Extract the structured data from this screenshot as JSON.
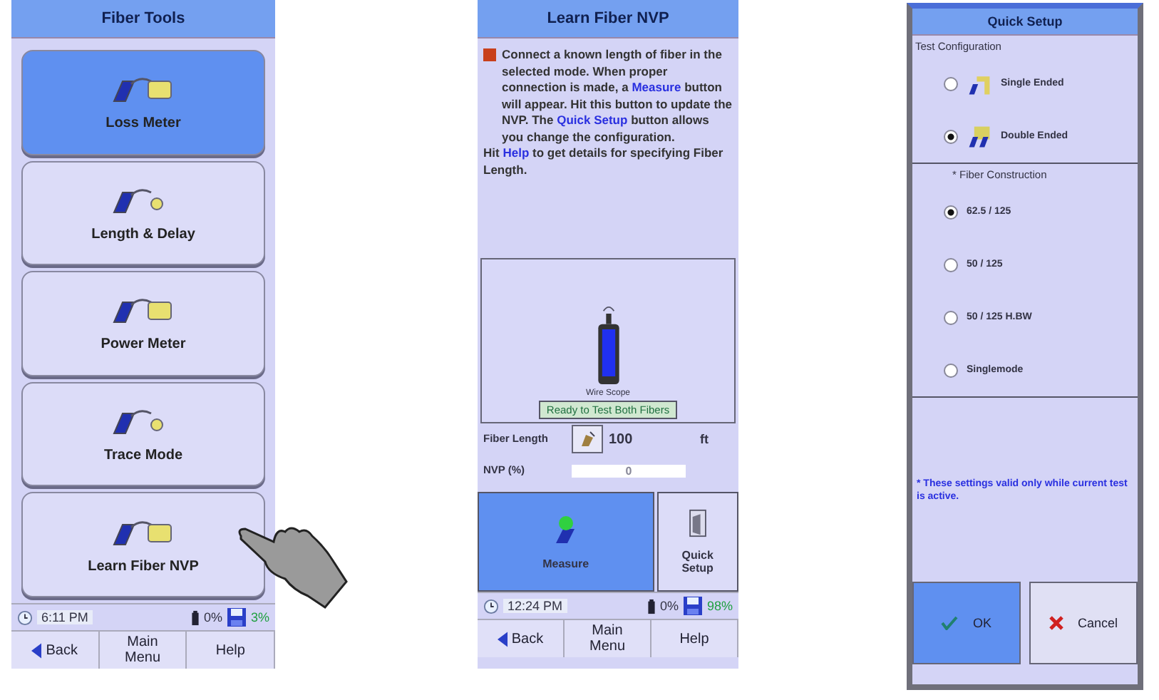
{
  "screens": [
    {
      "kind": "menu",
      "title": "Fiber Tools",
      "tiles": [
        {
          "label": "Loss Meter",
          "selected": true
        },
        {
          "label": "Length & Delay",
          "selected": false
        },
        {
          "label": "Power Meter",
          "selected": false
        },
        {
          "label": "Trace Mode",
          "selected": false
        },
        {
          "label": "Learn Fiber NVP",
          "selected": false
        }
      ],
      "status": {
        "time": "6:11 PM",
        "battery": "0%",
        "storage": "3%"
      },
      "nav": [
        "Back",
        "Main Menu",
        "Help"
      ]
    },
    {
      "kind": "nvp",
      "title": "Learn Fiber NVP",
      "paragraphs": [
        [
          {
            "text": "Connect a known length of fiber in the selected mode. When proper connection is made, a",
            "kind": "text"
          },
          {
            "text": "Measure",
            "kind": "link"
          },
          {
            "text": "button will appear. Hit this button to update the NVP. The",
            "kind": "text"
          },
          {
            "text": "Quick Setup",
            "kind": "link"
          },
          {
            "text": "button allows you change the configuration.",
            "kind": "text"
          }
        ],
        [
          {
            "text": "Hit",
            "kind": "text"
          },
          {
            "text": "Help",
            "kind": "link"
          },
          {
            "text": "to get details for specifying Fiber Length.",
            "kind": "text"
          }
        ]
      ],
      "device_label": "Wire Scope",
      "status_message": "Ready to Test Both Fibers",
      "fields": [
        {
          "label": "Fiber Length",
          "value": "100",
          "unit": "ft",
          "kind": "edit"
        },
        {
          "label": "NVP (%)",
          "value": "0",
          "kind": "readonly"
        }
      ],
      "actions": [
        {
          "label": "Measure",
          "selected": true,
          "kind": "measure"
        },
        {
          "label": "Quick Setup",
          "selected": false,
          "kind": "setup"
        }
      ],
      "status": {
        "time": "12:24 PM",
        "battery": "0%",
        "storage": "98%"
      },
      "nav": [
        "Back",
        "Main Menu",
        "Help"
      ]
    },
    {
      "kind": "dialog",
      "title": "Quick Setup",
      "sections": [
        {
          "heading": "Test Configuration",
          "options": [
            {
              "label": "Single Ended",
              "selected": false,
              "kind": "single"
            },
            {
              "label": "Double Ended",
              "selected": true,
              "kind": "double"
            }
          ]
        },
        {
          "heading": "* Fiber Construction",
          "options": [
            {
              "label": "62.5 / 125",
              "selected": true
            },
            {
              "label": "50 / 125",
              "selected": false
            },
            {
              "label": "50 / 125 H.BW",
              "selected": false
            },
            {
              "label": "Singlemode",
              "selected": false
            }
          ]
        }
      ],
      "note": "* These settings valid only while current test is active.",
      "buttons": [
        {
          "label": "OK",
          "selected": true,
          "kind": "ok"
        },
        {
          "label": "Cancel",
          "selected": false,
          "kind": "cancel"
        }
      ]
    }
  ]
}
